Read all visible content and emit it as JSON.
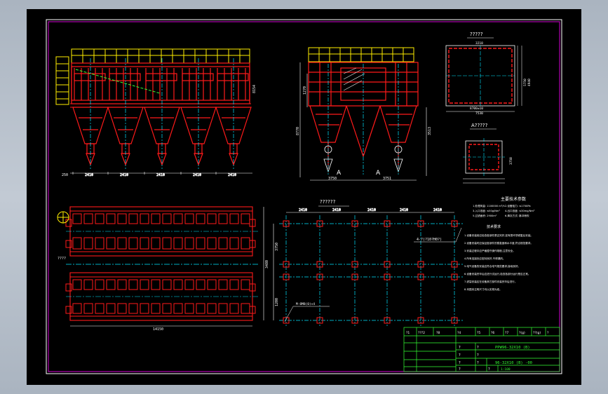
{
  "colors": {
    "background": "#000000",
    "frame_outer": "#ffffff",
    "frame_inner": "#d400d4",
    "structure": "#ff1a1a",
    "dimension": "#ffffff",
    "centerline": "#00e5ff",
    "roof": "#ffee00",
    "titleblock": "#33ff33",
    "hatch": "#e8e8e8"
  },
  "views": {
    "plan_a_title": "A?????",
    "top_right_title": "?????",
    "layout_title": "??????",
    "notes_title": "主要技术参数",
    "notes_subtitle": "技术要求",
    "section_mark_left": "A",
    "section_mark_right": "A"
  },
  "dims": {
    "front_bays": [
      "2410",
      "2410",
      "2410",
      "2410",
      "2410"
    ],
    "front_left": "250",
    "front_total_height": "8154",
    "front_mid_height": "3581",
    "side_bottom_left": "3750",
    "side_bottom_right": "3751",
    "side_height": "8770",
    "side_mid": "3513",
    "side_small": "1270",
    "plan_a_top": "3218",
    "plan_a_bottom": "8700±10",
    "plan_a_bottom2": "7530",
    "plan_a_right": "5750",
    "plan_a_right2": "4940",
    "box_right": "3750",
    "layout_bays": [
      "2410",
      "2410",
      "2410",
      "2410",
      "2410"
    ],
    "layout_left": "3750",
    "layout_left2": "1200",
    "layout_callout": "4-?(?10?H0?)",
    "layout_bottom_callout": "M-8M8(0)×4",
    "plan_width": "3480",
    "plan_total": "14150",
    "plan_side": "????"
  },
  "notes": {
    "params": [
      "1.处理风量: 1100000 m³/h",
      "2.设备阻力: ≤1700Pa",
      "3.入口浓度: ≤50g/Nm³",
      "4.出口浓度: ≤30mg/Nm³",
      "5.过滤面积: 2900m²",
      "6.清灰方式: 脉冲喷吹"
    ],
    "params_right": [
      "2.过滤风速: ≤1.0m/min",
      "4.漏风率: ≤2%",
      "6.滤袋规格: Φ130×6000",
      "8.压缩空气: 0.2~0.3MPa",
      "10.重量: 约60t"
    ],
    "requirements": [
      "1.设备安装前应检查各部件是否完好,如有损坏须修复后安装。",
      "2.设备安装时应保证各部件的垂直度和水平度,符合规范要求。",
      "3.安装过程中应严格遵守操作规程,注意安全。",
      "4.所有连接处应密封良好,不得漏风。",
      "5.电气设备的安装应符合电气规范要求,接地良好。",
      "6.设备安装完毕后应进行试运行,检查各部分运行是否正常。",
      "7.滤袋安装应在设备其它部件安装完毕后进行。",
      "8.本图未注明尺寸均以实物为准。"
    ]
  },
  "titleblock": {
    "header": [
      "?1",
      "???2",
      "?8",
      "?4",
      "?5",
      "?6",
      "?7",
      "?(g)",
      "??(g)",
      "?"
    ],
    "drawing_name": "PPW96-32X10 (B)",
    "drawing_no": "96-32X10 (B) -00",
    "scale": "1:100",
    "cells": [
      "?",
      "?",
      "?",
      "?",
      "?",
      "?",
      "?",
      "?"
    ]
  }
}
